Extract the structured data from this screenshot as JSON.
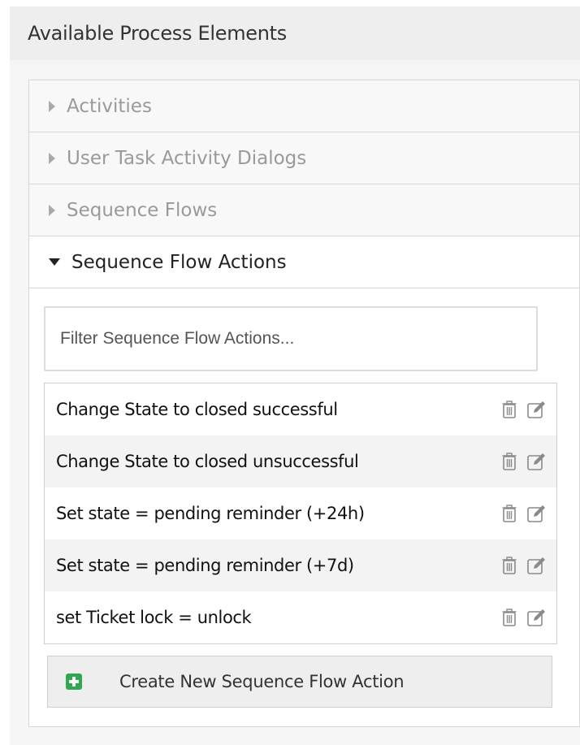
{
  "panel": {
    "title": "Available Process Elements"
  },
  "accordion": {
    "items": [
      {
        "label": "Activities"
      },
      {
        "label": "User Task Activity Dialogs"
      },
      {
        "label": "Sequence Flows"
      },
      {
        "label": "Sequence Flow Actions"
      }
    ]
  },
  "filter": {
    "placeholder": "Filter Sequence Flow Actions..."
  },
  "actions": [
    {
      "label": "Change State to closed successful"
    },
    {
      "label": "Change State to closed unsuccessful"
    },
    {
      "label": "Set state = pending reminder (+24h)"
    },
    {
      "label": "Set state = pending reminder (+7d)"
    },
    {
      "label": "set Ticket lock = unlock"
    }
  ],
  "create_button": {
    "label": "Create New Sequence Flow Action"
  },
  "colors": {
    "add_icon": "#2fa84f"
  },
  "icons": {
    "delete": "trash-icon",
    "edit": "edit-icon",
    "add": "plus-icon"
  }
}
